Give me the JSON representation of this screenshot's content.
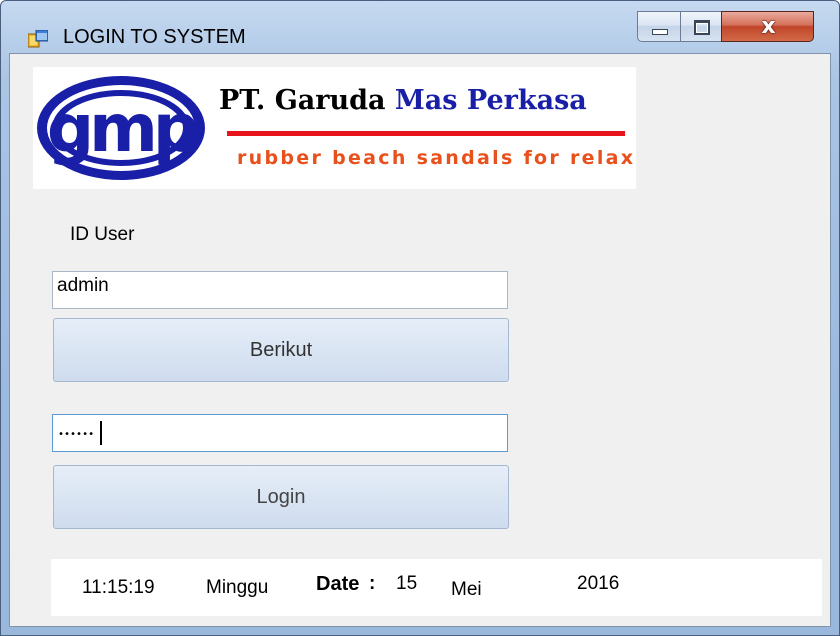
{
  "window": {
    "title": "LOGIN TO SYSTEM"
  },
  "logo": {
    "emblem_text": "gmp",
    "company_prefix": "PT. Garuda ",
    "company_highlight": "Mas Perkasa",
    "tagline": "rubber beach sandals for relax"
  },
  "form": {
    "id_user_label": "ID User",
    "id_user_value": "admin",
    "next_button_label": "Berikut",
    "password_mask": "••••••",
    "login_button_label": "Login"
  },
  "status": {
    "time": "11:15:19",
    "day_name": "Minggu",
    "date_label": "Date",
    "separator": ":",
    "day": "15",
    "month": "Mei",
    "year": "2016"
  },
  "colors": {
    "logo_blue": "#1a1fa8",
    "logo_red_line": "#e8141c",
    "tagline_orange": "#e8501c",
    "close_button": "#c0452a"
  }
}
